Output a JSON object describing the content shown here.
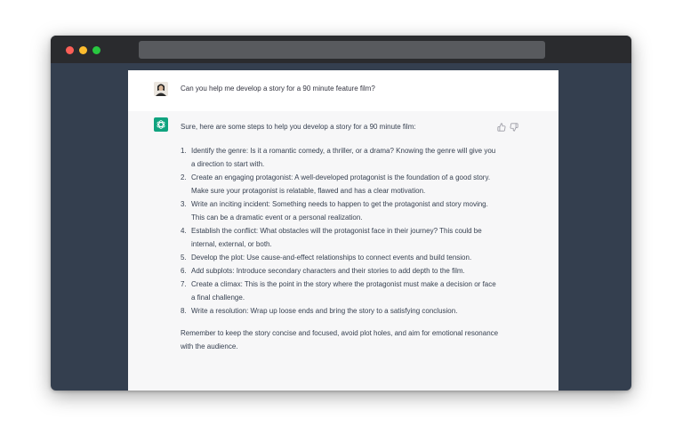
{
  "window": {
    "traffic_lights": [
      "close",
      "minimize",
      "zoom"
    ],
    "address_bar": ""
  },
  "conversation": {
    "user_message": "Can you help me develop a story for a 90 minute feature film?",
    "assistant": {
      "intro": "Sure, here are some steps to help you develop a story for a 90 minute film:",
      "steps": [
        {
          "num": "1.",
          "text": "Identify the genre: Is it a romantic comedy, a thriller, or a drama? Knowing the genre will give you a direction to start with."
        },
        {
          "num": "2.",
          "text": "Create an engaging protagonist: A well-developed protagonist is the foundation of a good story. Make sure your protagonist is relatable, flawed and has a clear motivation."
        },
        {
          "num": "3.",
          "text": "Write an inciting incident: Something needs to happen to get the protagonist and story moving. This can be a dramatic event or a personal realization."
        },
        {
          "num": "4.",
          "text": "Establish the conflict: What obstacles will the protagonist face in their journey? This could be internal, external, or both."
        },
        {
          "num": "5.",
          "text": "Develop the plot: Use cause-and-effect relationships to connect events and build tension."
        },
        {
          "num": "6.",
          "text": "Add subplots: Introduce secondary characters and their stories to add depth to the film."
        },
        {
          "num": "7.",
          "text": "Create a climax: This is the point in the story where the protagonist must make a decision or face a final challenge."
        },
        {
          "num": "8.",
          "text": "Write a resolution: Wrap up loose ends and bring the story to a satisfying conclusion."
        }
      ],
      "outro": "Remember to keep the story concise and focused, avoid plot holes, and aim for emotional resonance with the audience."
    },
    "icons": {
      "user_avatar": "user-avatar-icon",
      "assistant_avatar": "openai-logo-icon",
      "thumbs_up": "thumbs-up-icon",
      "thumbs_down": "thumbs-down-icon"
    }
  },
  "colors": {
    "desktop": "#343f4f",
    "titlebar": "#2a2b2e",
    "assistant_bg": "#f7f7f8",
    "assistant_avatar": "#10a37f",
    "text": "#374151"
  }
}
